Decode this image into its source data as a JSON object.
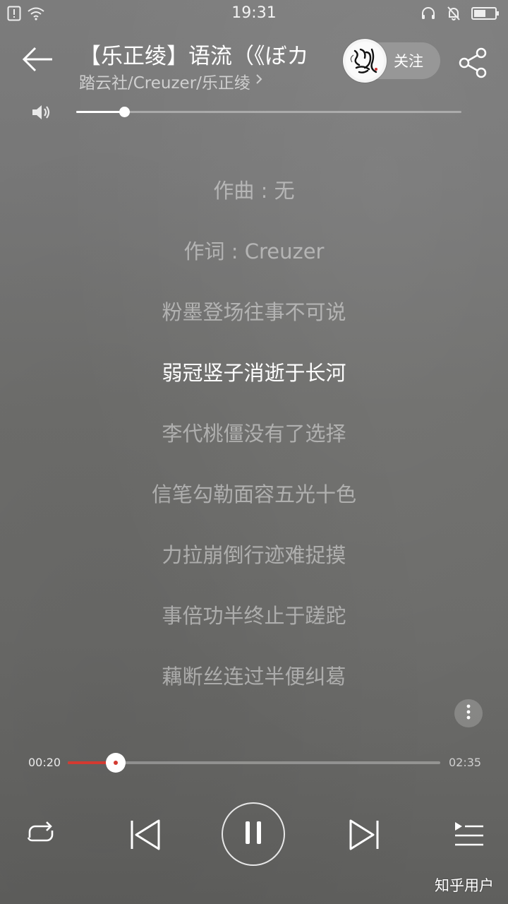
{
  "status_bar": {
    "time": "19:31"
  },
  "header": {
    "title": "【乐正绫】语流（《ぼカ",
    "artist": "踏云社/Creuzer/乐正绫",
    "follow_label": "关注",
    "avatar_text": "踏雲社"
  },
  "volume": {
    "level": 0.125
  },
  "lyrics": {
    "lines": [
      "作曲 : 无",
      "作词 : Creuzer",
      "粉墨登场往事不可说",
      "弱冠竖子消逝于长河",
      "李代桃僵没有了选择",
      "信笔勾勒面容五光十色",
      "力拉崩倒行迹难捉摸",
      "事倍功半终止于蹉跎",
      "藕断丝连过半便纠葛"
    ],
    "active_index": 3
  },
  "playback": {
    "current_time": "00:20",
    "total_time": "02:35",
    "progress": 0.129
  },
  "watermark": "知乎用户",
  "colors": {
    "accent": "#d33a31"
  }
}
